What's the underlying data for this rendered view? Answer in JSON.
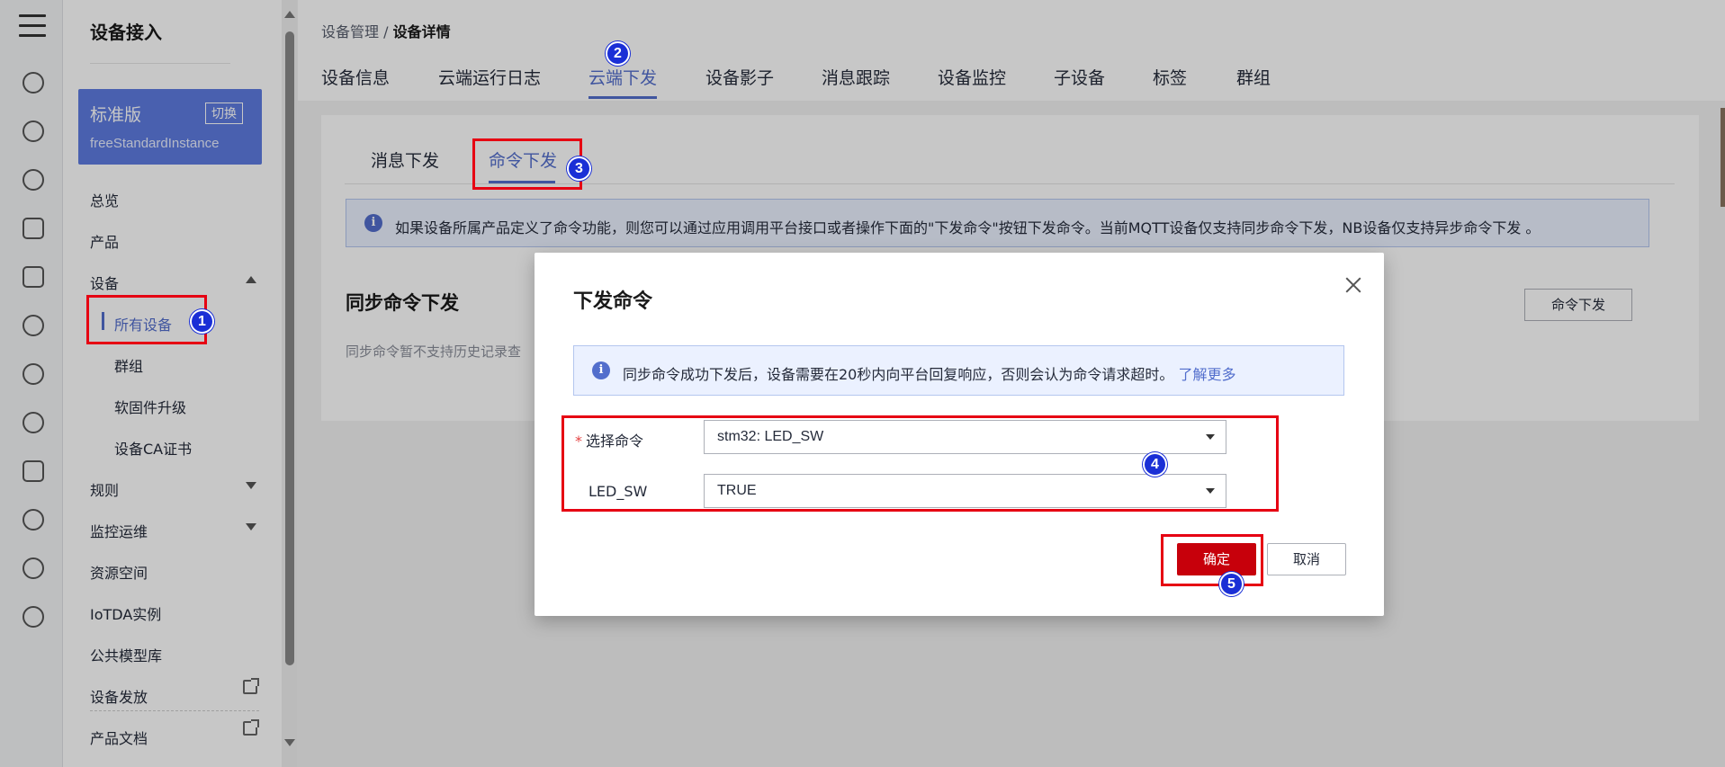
{
  "nav": {
    "title": "设备接入",
    "edition": {
      "name": "标准版",
      "switch_label": "切换",
      "instance": "freeStandardInstance"
    },
    "items": {
      "overview": "总览",
      "product": "产品",
      "device": "设备",
      "all_devices": "所有设备",
      "group": "群组",
      "firmware": "软固件升级",
      "ca_cert": "设备CA证书",
      "rules": "规则",
      "monitor": "监控运维",
      "resource_space": "资源空间",
      "iotda_instance": "IoTDA实例",
      "model_library": "公共模型库",
      "provisioning": "设备发放",
      "product_docs": "产品文档"
    }
  },
  "breadcrumb": {
    "parent": "设备管理 / ",
    "current": "设备详情"
  },
  "tabs": [
    "设备信息",
    "云端运行日志",
    "云端下发",
    "设备影子",
    "消息跟踪",
    "设备监控",
    "子设备",
    "标签",
    "群组"
  ],
  "subtabs": [
    "消息下发",
    "命令下发"
  ],
  "info_bar": "如果设备所属产品定义了命令功能，则您可以通过应用调用平台接口或者操作下面的\"下发命令\"按钮下发命令。当前MQTT设备仅支持同步命令下发，NB设备仅支持异步命令下发 。",
  "sync": {
    "title": "同步命令下发",
    "note": "同步命令暂不支持历史记录查",
    "button": "命令下发"
  },
  "dialog": {
    "title": "下发命令",
    "info": "同步命令成功下发后，设备需要在20秒内向平台回复响应，否则会认为命令请求超时。",
    "learn_more": "了解更多",
    "field1_label": "选择命令",
    "field1_required": "*",
    "field1_value": "stm32: LED_SW",
    "field2_label": "LED_SW",
    "field2_value": "TRUE",
    "ok": "确定",
    "cancel": "取消"
  },
  "steps": [
    "1",
    "2",
    "3",
    "4",
    "5"
  ],
  "colors": {
    "accent": "#526ecc",
    "primary_button": "#c7000b",
    "annotation_red": "#e60012",
    "step_badge": "#1a2fd6"
  }
}
